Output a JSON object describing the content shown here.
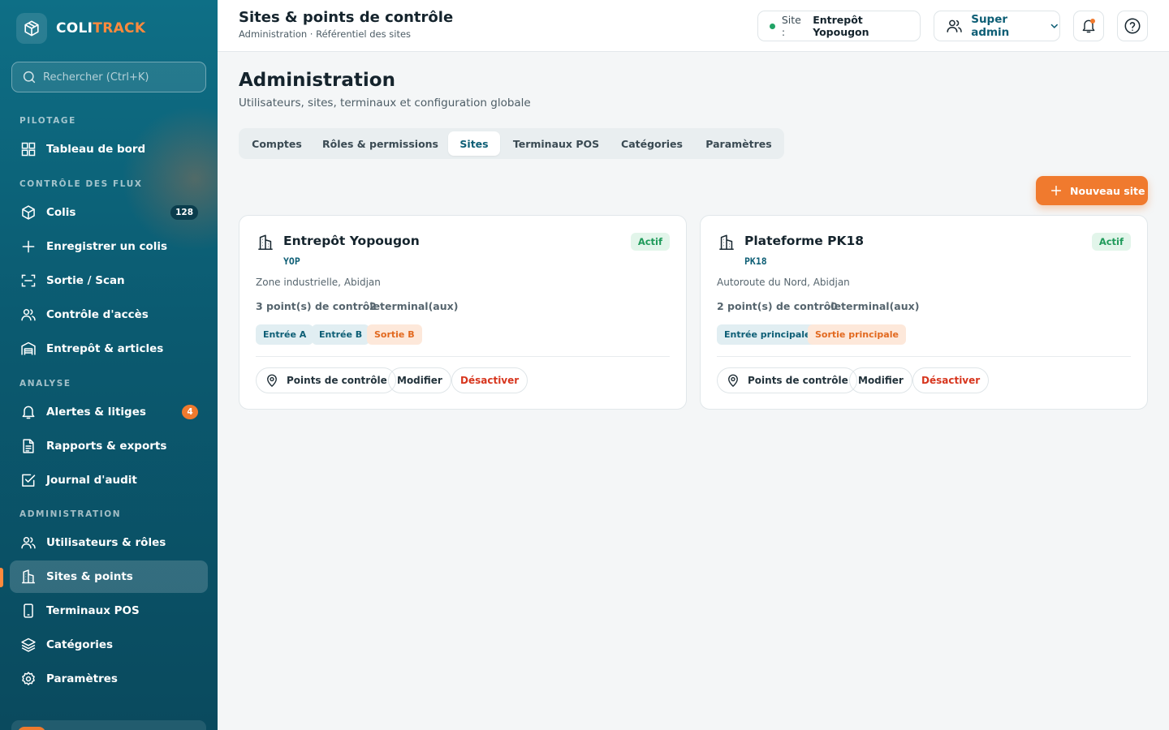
{
  "brand": {
    "name_part1": "COLI",
    "name_part2": "TRACK"
  },
  "search": {
    "placeholder": "Rechercher (Ctrl+K)"
  },
  "sidebar": {
    "sections": {
      "pilotage": "PILOTAGE",
      "flux": "CONTRÔLE DES FLUX",
      "analyse": "ANALYSE",
      "admin": "ADMINISTRATION"
    },
    "items": {
      "dashboard": "Tableau de bord",
      "parcels": "Colis",
      "parcels_count": "128",
      "register": "Enregistrer un colis",
      "exit_scan": "Sortie / Scan",
      "access": "Contrôle d'accès",
      "warehouse": "Entrepôt & articles",
      "alerts": "Alertes & litiges",
      "alerts_count": "4",
      "reports": "Rapports & exports",
      "audit": "Journal d'audit",
      "users": "Utilisateurs & rôles",
      "sites": "Sites & points",
      "pos": "Terminaux POS",
      "categories": "Catégories",
      "settings": "Paramètres"
    }
  },
  "header": {
    "title": "Sites & points de contrôle",
    "breadcrumb": "Administration · Référentiel des sites",
    "site_label": "Site :",
    "site_value": "Entrepôt Yopougon",
    "user": "Super admin"
  },
  "main": {
    "title": "Administration",
    "subtitle": "Utilisateurs, sites, terminaux et configuration globale",
    "tabs": [
      "Comptes",
      "Rôles & permissions",
      "Sites",
      "Terminaux POS",
      "Catégories",
      "Paramètres"
    ],
    "new_button": "Nouveau site"
  },
  "sites": [
    {
      "name": "Entrepôt Yopougon",
      "code": "YOP",
      "status": "Actif",
      "address": "Zone industrielle, Abidjan",
      "checkpoints": "3 point(s) de contrôle",
      "terminals": "2 terminal(aux)",
      "chips": [
        {
          "label": "Entrée A",
          "kind": "in"
        },
        {
          "label": "Entrée B",
          "kind": "in"
        },
        {
          "label": "Sortie B",
          "kind": "out"
        }
      ],
      "actions": {
        "points": "Points de contrôle",
        "edit": "Modifier",
        "disable": "Désactiver"
      }
    },
    {
      "name": "Plateforme PK18",
      "code": "PK18",
      "status": "Actif",
      "address": "Autoroute du Nord, Abidjan",
      "checkpoints": "2 point(s) de contrôle",
      "terminals": "0 terminal(aux)",
      "chips": [
        {
          "label": "Entrée principale",
          "kind": "in"
        },
        {
          "label": "Sortie principale",
          "kind": "out"
        }
      ],
      "actions": {
        "points": "Points de contrôle",
        "edit": "Modifier",
        "disable": "Désactiver"
      }
    }
  ],
  "colors": {
    "primary": "#0d5e75",
    "accent": "#f07a2e",
    "success": "#1f9a5a",
    "danger": "#d7351d"
  }
}
